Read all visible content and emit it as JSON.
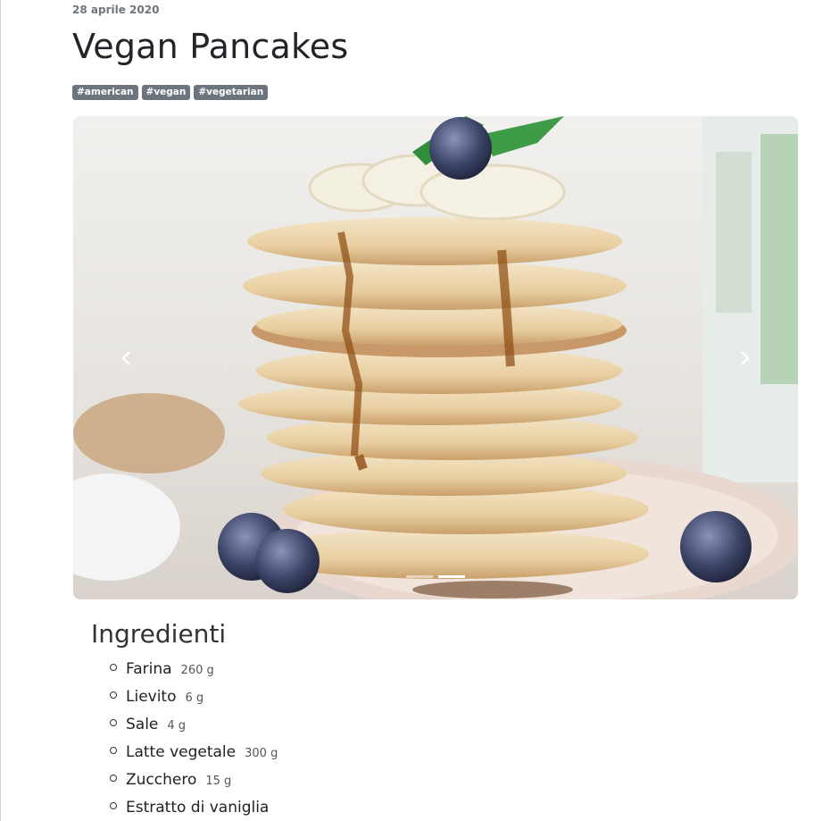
{
  "post": {
    "date": "28 aprile 2020",
    "title": "Vegan Pancakes",
    "tags": [
      "#american",
      "#vegan",
      "#vegetarian"
    ]
  },
  "carousel": {
    "image_subject": "stack of pancakes with syrup, banana slices and blueberries",
    "slide_count": 2,
    "active_slide": 2
  },
  "ingredients": {
    "heading": "Ingredienti",
    "items": [
      {
        "name": "Farina",
        "qty": "260 g"
      },
      {
        "name": "Lievito",
        "qty": "6 g"
      },
      {
        "name": "Sale",
        "qty": "4 g"
      },
      {
        "name": "Latte vegetale",
        "qty": "300 g"
      },
      {
        "name": "Zucchero",
        "qty": "15 g"
      },
      {
        "name": "Estratto di vaniglia",
        "qty": ""
      }
    ]
  }
}
